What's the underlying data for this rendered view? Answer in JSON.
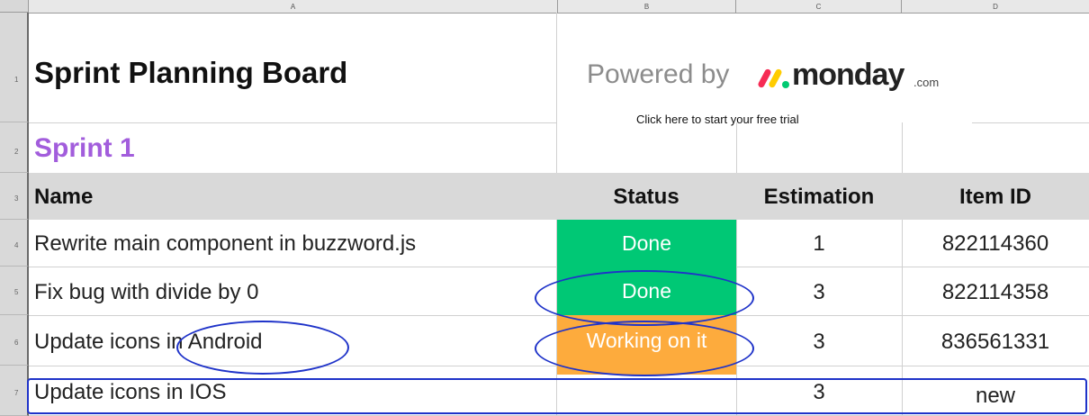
{
  "columns": [
    "A",
    "B",
    "C",
    "D"
  ],
  "rows": [
    "1",
    "2",
    "3",
    "4",
    "5",
    "6",
    "7"
  ],
  "title": "Sprint Planning Board",
  "group_name": "Sprint 1",
  "powered_by": "Powered by",
  "brand": "monday",
  "brand_suffix": ".com",
  "trial_link": "Click here to start your free trial",
  "headers": {
    "name": "Name",
    "status": "Status",
    "estimation": "Estimation",
    "item_id": "Item ID"
  },
  "items": [
    {
      "name": "Rewrite main component in buzzword.js",
      "status": "Done",
      "estimation": "1",
      "item_id": "822114360"
    },
    {
      "name": "Fix bug with divide by 0",
      "status": "Done",
      "estimation": "3",
      "item_id": "822114358"
    },
    {
      "name": "Update icons in Android",
      "status": "Working on it",
      "estimation": "3",
      "item_id": "836561331"
    },
    {
      "name": "Update icons in IOS",
      "status": "",
      "estimation": "3",
      "item_id": "new"
    }
  ],
  "colors": {
    "done": "#00c875",
    "working": "#fdab3d",
    "group": "#a25ddc",
    "header_bg": "#d9d9d9",
    "annotation": "#1f33c9"
  },
  "icons": {
    "brand_logo": "monday-logo-icon"
  }
}
